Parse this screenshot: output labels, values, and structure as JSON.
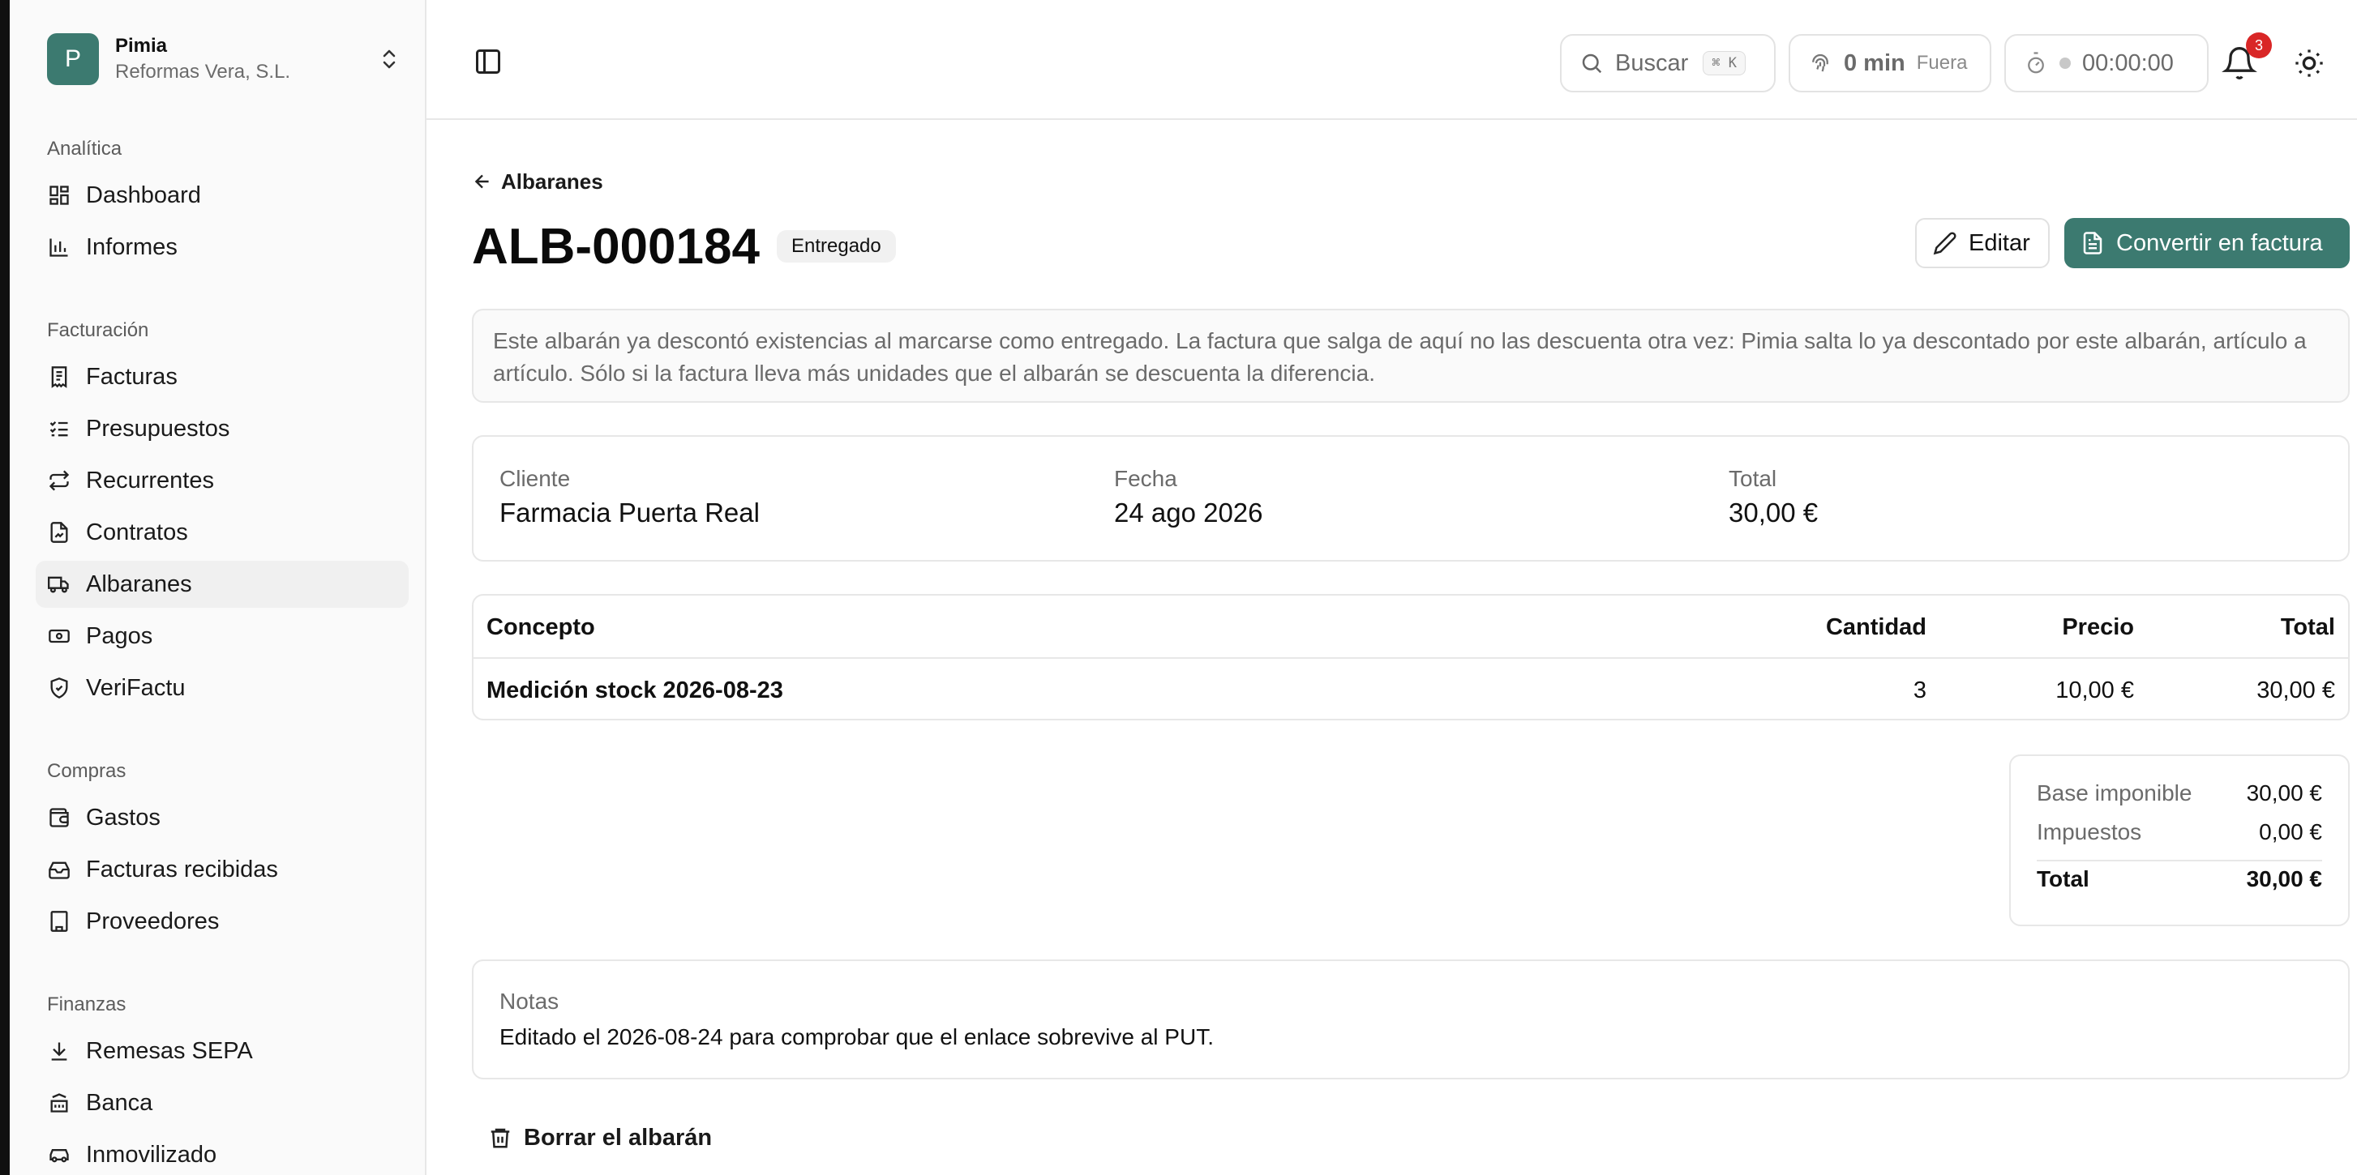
{
  "org": {
    "initial": "P",
    "name": "Pimia",
    "company": "Reformas Vera, S.L."
  },
  "sidebar": {
    "sections": [
      {
        "heading": "Analítica",
        "items": [
          {
            "label": "Dashboard",
            "icon": "dashboard-icon"
          },
          {
            "label": "Informes",
            "icon": "bar-chart-icon"
          }
        ]
      },
      {
        "heading": "Facturación",
        "items": [
          {
            "label": "Facturas",
            "icon": "receipt-icon"
          },
          {
            "label": "Presupuestos",
            "icon": "list-check-icon"
          },
          {
            "label": "Recurrentes",
            "icon": "repeat-icon"
          },
          {
            "label": "Contratos",
            "icon": "file-signature-icon"
          },
          {
            "label": "Albaranes",
            "icon": "truck-icon",
            "active": true
          },
          {
            "label": "Pagos",
            "icon": "banknote-icon"
          },
          {
            "label": "VeriFactu",
            "icon": "shield-check-icon"
          }
        ]
      },
      {
        "heading": "Compras",
        "items": [
          {
            "label": "Gastos",
            "icon": "wallet-icon"
          },
          {
            "label": "Facturas recibidas",
            "icon": "inbox-icon"
          },
          {
            "label": "Proveedores",
            "icon": "building-icon"
          }
        ]
      },
      {
        "heading": "Finanzas",
        "items": [
          {
            "label": "Remesas SEPA",
            "icon": "download-icon"
          },
          {
            "label": "Banca",
            "icon": "bank-icon"
          },
          {
            "label": "Inmovilizado",
            "icon": "car-icon"
          }
        ]
      }
    ]
  },
  "topbar": {
    "search_label": "Buscar",
    "search_shortcut": "⌘ K",
    "clock_value": "0 min",
    "clock_state": "Fuera",
    "timer_value": "00:00:00",
    "notifications_count": "3"
  },
  "page": {
    "back_label": "Albaranes",
    "title": "ALB-000184",
    "status": "Entregado",
    "edit_label": "Editar",
    "convert_label": "Convertir en factura",
    "info_text": "Este albarán ya descontó existencias al marcarse como entregado. La factura que salga de aquí no las descuenta otra vez: Pimia salta lo ya descontado por este albarán, artículo a artículo. Sólo si la factura lleva más unidades que el albarán se descuenta la diferencia.",
    "summary": {
      "client_label": "Cliente",
      "client_value": "Farmacia Puerta Real",
      "date_label": "Fecha",
      "date_value": "24 ago 2026",
      "total_label": "Total",
      "total_value": "30,00 €"
    },
    "lines": {
      "headers": {
        "concept": "Concepto",
        "qty": "Cantidad",
        "price": "Precio",
        "total": "Total"
      },
      "rows": [
        {
          "concept": "Medición stock 2026-08-23",
          "qty": "3",
          "price": "10,00 €",
          "total": "30,00 €"
        }
      ]
    },
    "totals": {
      "base_label": "Base imponible",
      "base_value": "30,00 €",
      "tax_label": "Impuestos",
      "tax_value": "0,00 €",
      "total_label": "Total",
      "total_value": "30,00 €"
    },
    "notes": {
      "label": "Notas",
      "text": "Editado el 2026-08-24 para comprobar que el enlace sobrevive al PUT."
    },
    "delete_label": "Borrar el albarán"
  },
  "colors": {
    "accent": "#3c7a70",
    "badge": "#d92626",
    "border": "#e7e7e7",
    "muted": "#6b6b6b"
  }
}
